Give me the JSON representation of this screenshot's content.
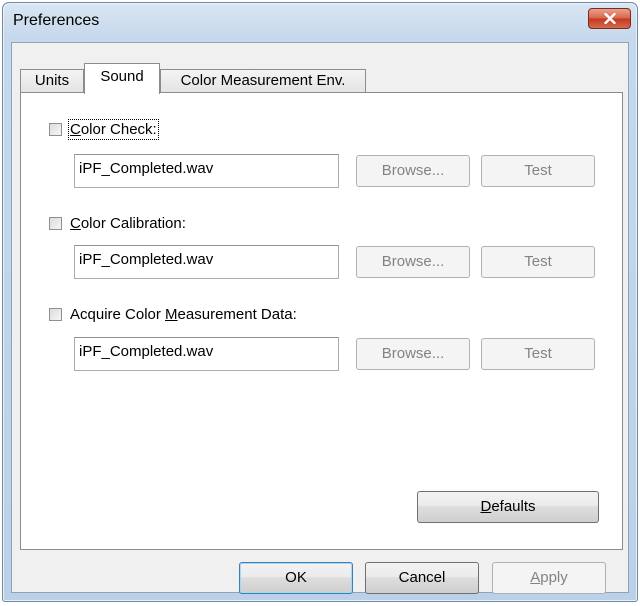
{
  "window": {
    "title": "Preferences"
  },
  "tabs": [
    {
      "label": "Units"
    },
    {
      "label": "Sound"
    },
    {
      "label": "Color Measurement Env."
    }
  ],
  "sound": {
    "items": [
      {
        "label_pre": "",
        "label_mnemonic": "C",
        "label_post": "olor Check:",
        "file": "iPF_Completed.wav",
        "browse_label": "Browse...",
        "test_label": "Test"
      },
      {
        "label_pre": "",
        "label_mnemonic": "C",
        "label_post": "olor Calibration:",
        "file": "iPF_Completed.wav",
        "browse_label": "Browse...",
        "test_label": "Test"
      },
      {
        "label_pre": "Acquire Color ",
        "label_mnemonic": "M",
        "label_post": "easurement Data:",
        "file": "iPF_Completed.wav",
        "browse_label": "Browse...",
        "test_label": "Test"
      }
    ],
    "defaults_mnemonic": "D",
    "defaults_rest": "efaults"
  },
  "footer": {
    "ok_label": "OK",
    "cancel_label": "Cancel",
    "apply_mnemonic": "A",
    "apply_rest": "pply"
  }
}
